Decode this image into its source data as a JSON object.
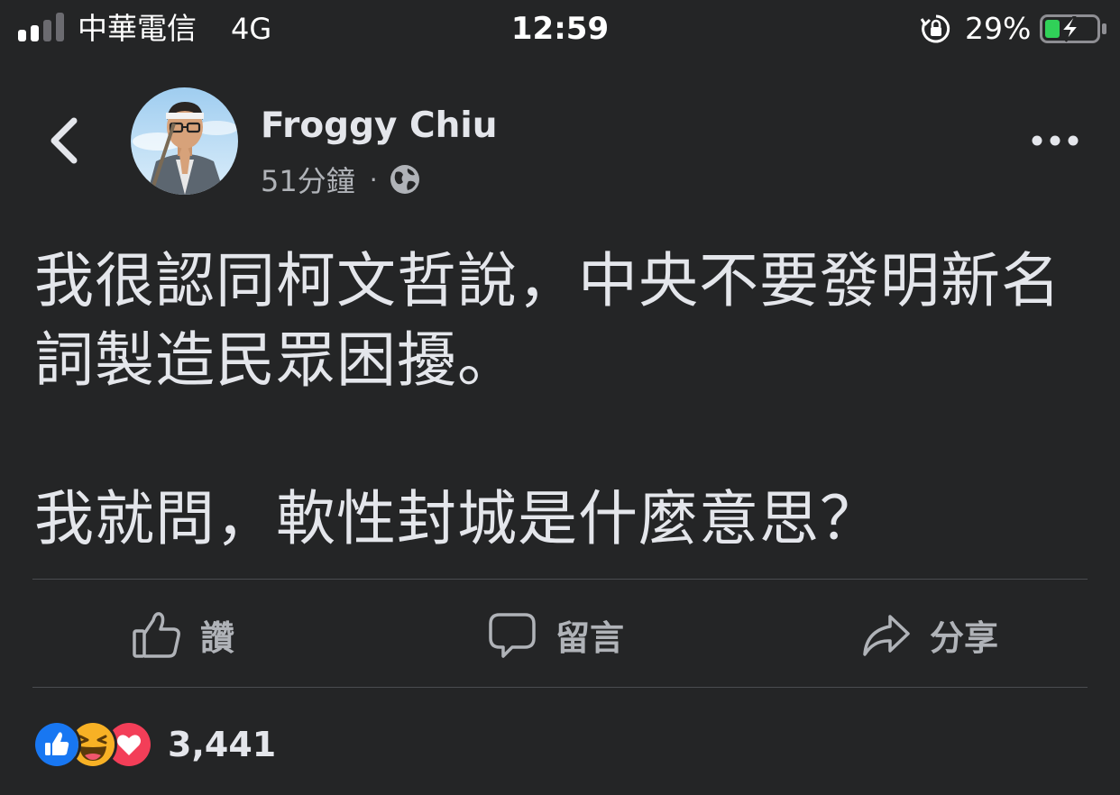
{
  "status_bar": {
    "carrier": "中華電信",
    "network": "4G",
    "time": "12:59",
    "battery_percent": "29%",
    "battery_level": 0.29,
    "signal_bars": 2,
    "signal_bars_total": 4
  },
  "post": {
    "author": "Froggy Chiu",
    "timestamp": "51分鐘",
    "separator": "·",
    "privacy_icon": "globe-icon",
    "paragraphs": [
      "我很認同柯文哲說，中央不要發明新名詞製造民眾困擾。",
      "我就問，軟性封城是什麼意思？"
    ]
  },
  "actions": {
    "like": "讚",
    "comment": "留言",
    "share": "分享"
  },
  "reactions": {
    "types": [
      "like",
      "haha",
      "love"
    ],
    "count": "3,441"
  },
  "colors": {
    "background": "#242526",
    "text_primary": "#e4e6eb",
    "text_secondary": "#b0b3b8",
    "like_blue": "#1877f2",
    "love_red": "#f33e58",
    "haha_yellow": "#f7b125",
    "battery_green": "#30d158"
  }
}
